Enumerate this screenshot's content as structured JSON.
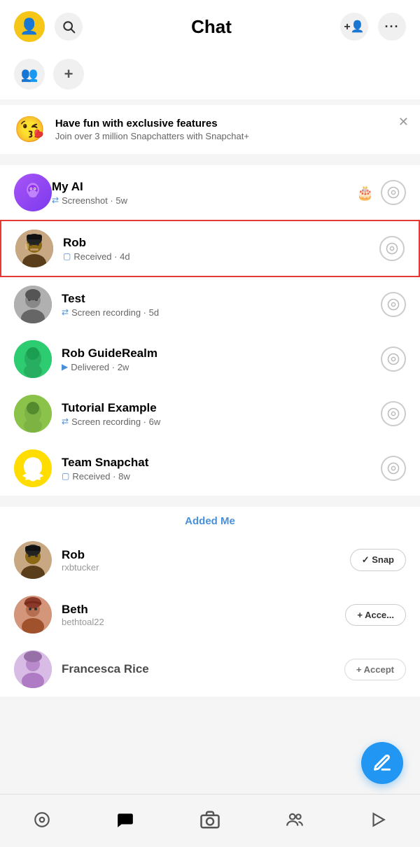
{
  "header": {
    "title": "Chat",
    "add_friend_label": "+👤",
    "more_label": "···"
  },
  "subheader": {
    "groups_icon": "👥",
    "add_icon": "+"
  },
  "promo": {
    "emoji": "😘",
    "title": "Have fun with exclusive features",
    "subtitle": "Join over 3 million Snapchatters with Snapchat+"
  },
  "chats": [
    {
      "id": "my-ai",
      "name": "My AI",
      "status_icon": "🔀",
      "status": "Screenshot · 5w",
      "avatar_emoji": "🤖",
      "highlighted": false,
      "action_icon": "⊙"
    },
    {
      "id": "rob",
      "name": "Rob",
      "status_icon": "🔲",
      "status": "Received · 4d",
      "avatar_emoji": "🧑",
      "highlighted": true,
      "action_icon": "⊙"
    },
    {
      "id": "test",
      "name": "Test",
      "status_icon": "🔀",
      "status": "Screen recording · 5d",
      "avatar_emoji": "🧑",
      "highlighted": false,
      "action_icon": "⊙"
    },
    {
      "id": "rob-guiderealm",
      "name": "Rob GuideRealm",
      "status_icon": "▶",
      "status": "Delivered · 2w",
      "avatar_emoji": "🟢",
      "highlighted": false,
      "action_icon": "⊙"
    },
    {
      "id": "tutorial-example",
      "name": "Tutorial Example",
      "status_icon": "🔀",
      "status": "Screen recording · 6w",
      "avatar_emoji": "🟢",
      "highlighted": false,
      "action_icon": "⊙"
    },
    {
      "id": "team-snapchat",
      "name": "Team Snapchat",
      "status_icon": "🔲",
      "status": "Received · 8w",
      "avatar_emoji": "👻",
      "highlighted": false,
      "action_icon": "⊙"
    }
  ],
  "added_me_label": "Added Me",
  "added_users": [
    {
      "id": "rob-added",
      "name": "Rob",
      "username": "rxbtucker",
      "avatar_emoji": "🧑",
      "action_label": "✓ Snap"
    },
    {
      "id": "beth-added",
      "name": "Beth",
      "username": "bethtoal22",
      "avatar_emoji": "👩",
      "action_label": "+ Acce..."
    },
    {
      "id": "francesca-rice",
      "name": "Francesca Rice",
      "username": "",
      "avatar_emoji": "👩",
      "action_label": "+ Accept"
    }
  ],
  "fab_icon": "✏",
  "nav": {
    "items": [
      {
        "id": "map",
        "icon": "◎",
        "label": "Map"
      },
      {
        "id": "chat",
        "icon": "💬",
        "label": "Chat",
        "active": true
      },
      {
        "id": "camera",
        "icon": "⊙",
        "label": "Camera"
      },
      {
        "id": "friends",
        "icon": "👥",
        "label": "Friends"
      },
      {
        "id": "play",
        "icon": "▷",
        "label": "Spotlight"
      }
    ]
  }
}
